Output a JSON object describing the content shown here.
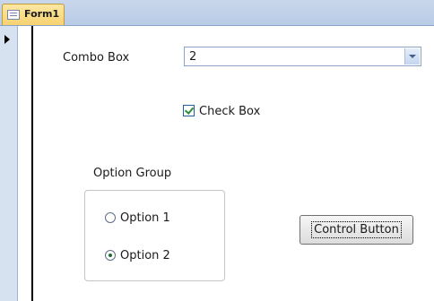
{
  "tab": {
    "title": "Form1"
  },
  "combo": {
    "label": "Combo Box",
    "value": "2"
  },
  "checkbox": {
    "label": "Check Box",
    "checked": true
  },
  "option_group": {
    "label": "Option Group",
    "options": [
      {
        "label": "Option 1",
        "selected": false
      },
      {
        "label": "Option 2",
        "selected": true
      }
    ]
  },
  "button": {
    "label": "Control Button"
  }
}
